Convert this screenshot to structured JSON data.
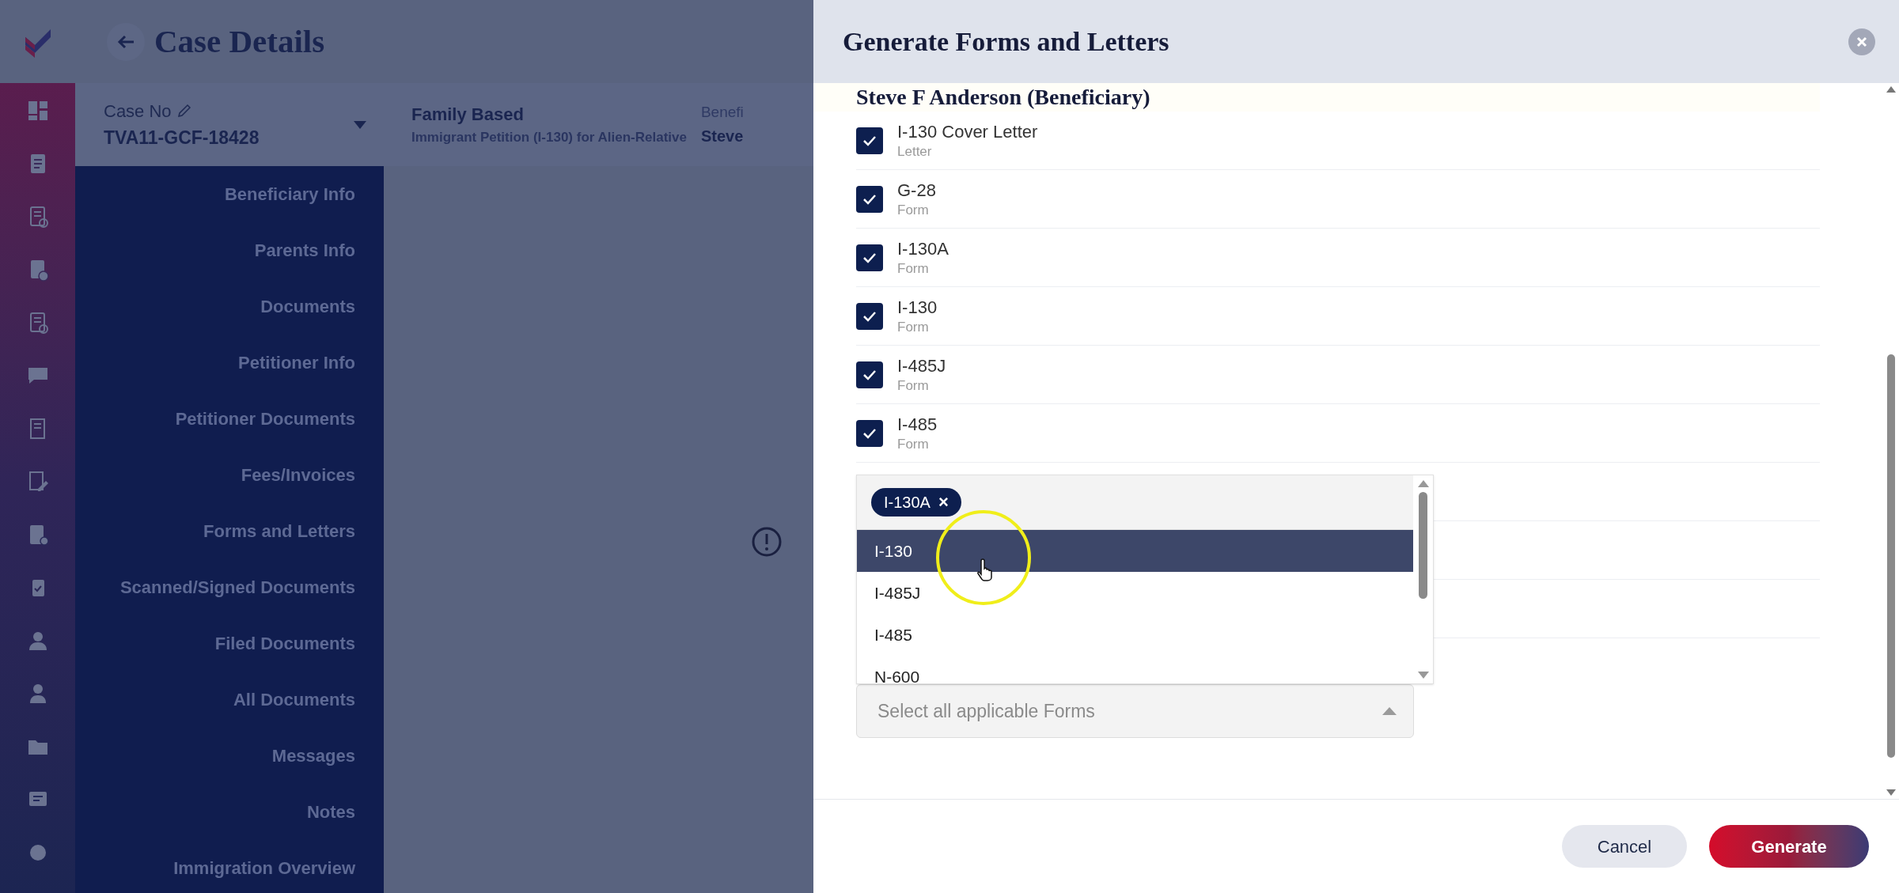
{
  "page": {
    "title": "Case Details"
  },
  "case_bar": {
    "case_no_label": "Case No",
    "case_no": "TVA11-GCF-18428",
    "category": "Family Based",
    "petition": "Immigrant Petition (I-130) for Alien-Relative",
    "beneficiary_label": "Benefi",
    "beneficiary": "Steve"
  },
  "nav": [
    "Beneficiary Info",
    "Parents Info",
    "Documents",
    "Petitioner Info",
    "Petitioner Documents",
    "Fees/Invoices",
    "Forms and Letters",
    "Scanned/Signed Documents",
    "Filed Documents",
    "All Documents",
    "Messages",
    "Notes",
    "Immigration Overview"
  ],
  "dialog": {
    "title": "Generate Forms and Letters",
    "section": "Steve F Anderson (Beneficiary)",
    "items": [
      {
        "name": "I-130 Cover Letter",
        "type": "Letter",
        "checked": true
      },
      {
        "name": "G-28",
        "type": "Form",
        "checked": true
      },
      {
        "name": "I-130A",
        "type": "Form",
        "checked": true
      },
      {
        "name": "I-130",
        "type": "Form",
        "checked": true
      },
      {
        "name": "I-485J",
        "type": "Form",
        "checked": true
      },
      {
        "name": "I-485",
        "type": "Form",
        "checked": true
      }
    ],
    "picker": {
      "chips": [
        "I-130A"
      ],
      "chip_remove": "×",
      "options": [
        {
          "label": "I-130",
          "selected": true
        },
        {
          "label": "I-485J",
          "selected": false
        },
        {
          "label": "I-485",
          "selected": false
        },
        {
          "label": "N-600",
          "selected": false
        }
      ],
      "placeholder": "Select all applicable Forms"
    },
    "buttons": [
      {
        "label": "Cancel",
        "kind": "secondary"
      },
      {
        "label": "Generate",
        "kind": "primary"
      }
    ]
  }
}
